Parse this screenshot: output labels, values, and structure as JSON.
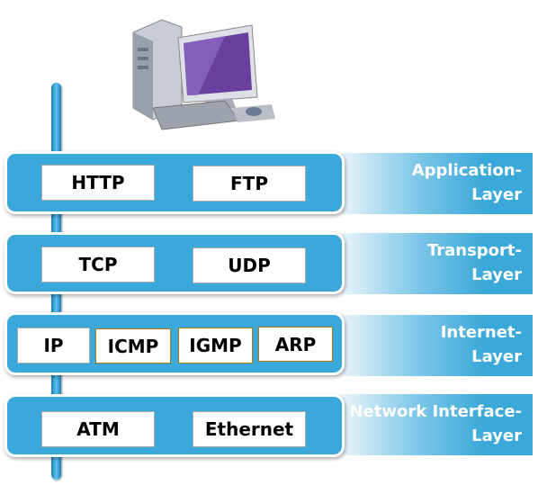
{
  "layers": [
    {
      "label_line1": "Application-",
      "label_line2": "Layer",
      "protocols": [
        "HTTP",
        "FTP"
      ]
    },
    {
      "label_line1": "Transport-",
      "label_line2": "Layer",
      "protocols": [
        "TCP",
        "UDP"
      ]
    },
    {
      "label_line1": "Internet-",
      "label_line2": "Layer",
      "protocols": [
        "IP",
        "ICMP",
        "IGMP",
        "ARP"
      ]
    },
    {
      "label_line1": "Network Interface-",
      "label_line2": "Layer",
      "protocols": [
        "ATM",
        "Ethernet"
      ]
    }
  ],
  "colors": {
    "layer": "#3aa8da",
    "monitor": "#6a3fa0"
  }
}
